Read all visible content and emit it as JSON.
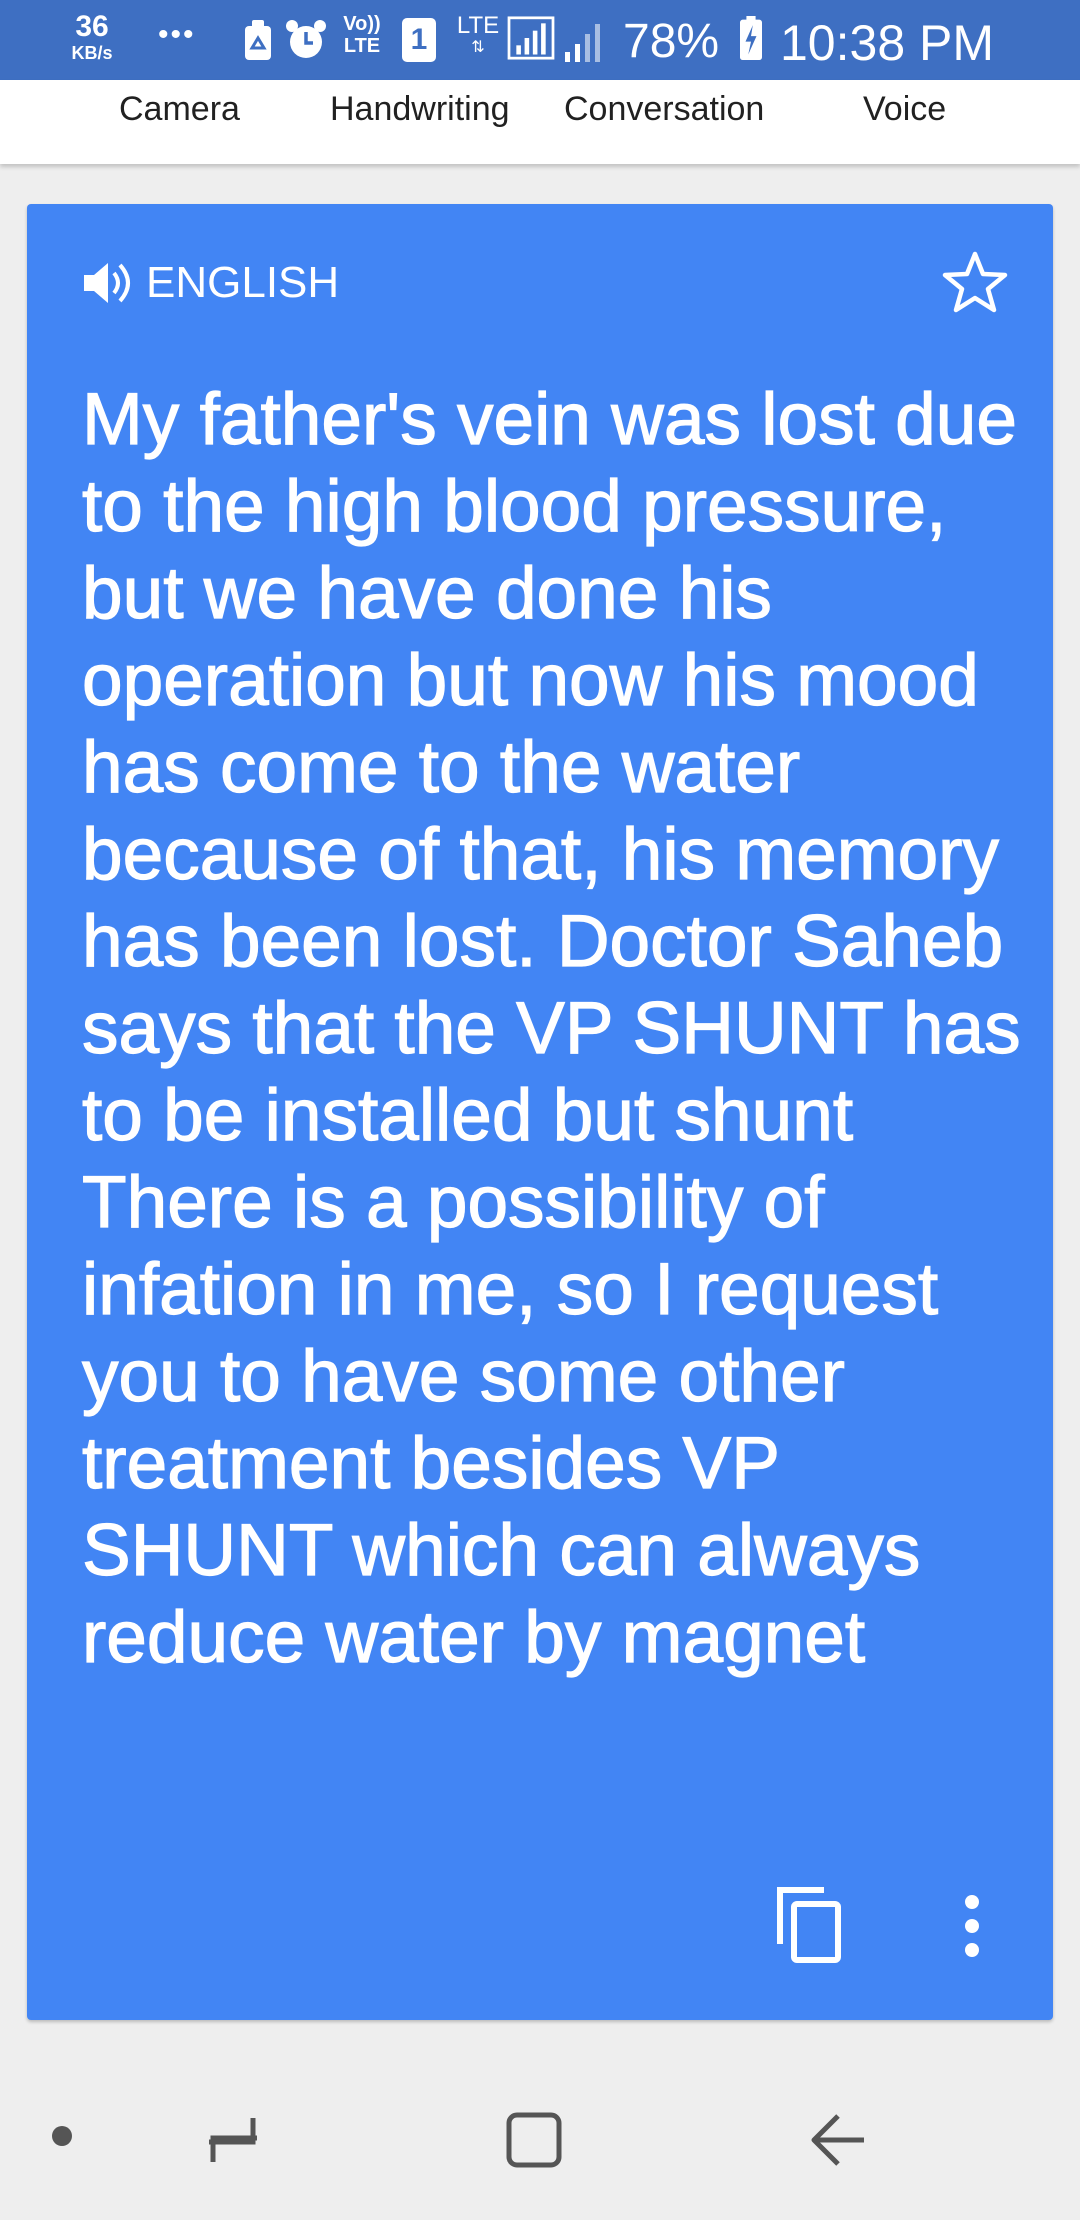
{
  "status_bar": {
    "net_speed": "36",
    "net_speed_unit": "KB/s",
    "overflow": "•••",
    "volte": "Vo))",
    "volte_sub": "LTE",
    "sim": "1",
    "lte": "LTE",
    "battery_pct": "78%",
    "time": "10:38 PM",
    "icons": [
      "clean-icon",
      "alarm-icon",
      "volte-icon",
      "sim-icon",
      "lte-signal-icon",
      "signal-icon",
      "battery-charging-icon"
    ]
  },
  "tabs": [
    {
      "label": "Camera"
    },
    {
      "label": "Handwriting"
    },
    {
      "label": "Conversation"
    },
    {
      "label": "Voice"
    }
  ],
  "card": {
    "language": "ENGLISH",
    "translation": "My father's vein was lost due to the high blood pressure, but we have done his operation but now his mood has come to the water because of that, his memory has been lost. Doctor Saheb says that the VP SHUNT has to be installed but shunt There is a possibility of infation in me, so I request you to have some other treatment besides VP SHUNT which can always reduce water by magnet",
    "icons": [
      "speaker-icon",
      "star-icon",
      "copy-icon",
      "more-vert-icon"
    ]
  },
  "nav_bar": {
    "icons": [
      "dot-icon",
      "recents-icon",
      "home-icon",
      "back-icon"
    ]
  },
  "colors": {
    "status_bar": "#3e6fc2",
    "card": "#4285f4",
    "background": "#eeeeee"
  }
}
